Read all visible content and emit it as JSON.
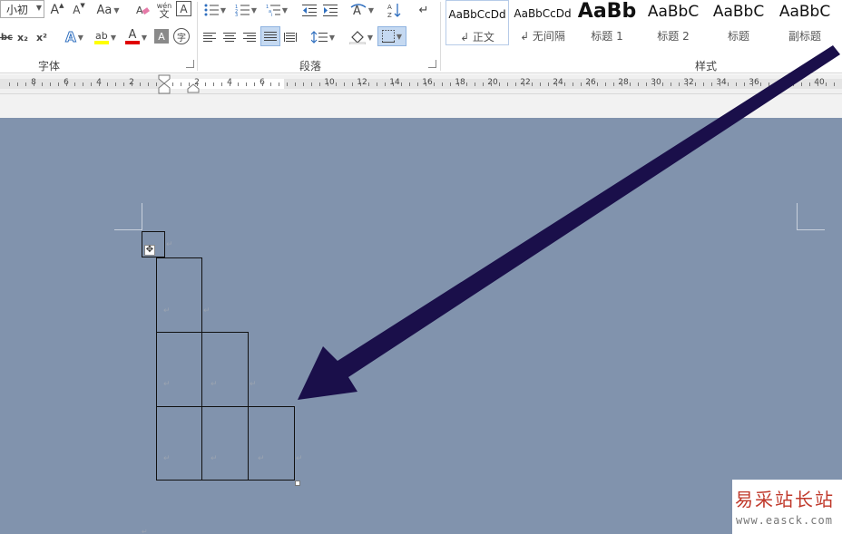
{
  "ribbon": {
    "font": {
      "size_value": "小初",
      "clear_format_icon": "eraser-icon",
      "phonetic_label": "wén",
      "phonetic_char": "文",
      "char_border_label": "A",
      "case_label": "Aa",
      "grow_label": "A",
      "shrink_label": "A",
      "strikethrough_label": "abc",
      "subscript_label": "x₂",
      "superscript_label": "x²",
      "text_effect_label": "A",
      "highlight_label": "ab",
      "font_color_label": "A",
      "char_shading_label": "A",
      "enclose_label": "字",
      "group_label": "字体"
    },
    "paragraph": {
      "group_label": "段落"
    },
    "styles": {
      "group_label": "样式",
      "tiles": [
        {
          "preview": "AaBbCcDd",
          "name": "↲ 正文"
        },
        {
          "preview": "AaBbCcDd",
          "name": "↲ 无间隔"
        },
        {
          "preview": "AaBb",
          "name": "标题 1"
        },
        {
          "preview": "AaBbC",
          "name": "标题 2"
        },
        {
          "preview": "AaBbC",
          "name": "标题"
        },
        {
          "preview": "AaBbC",
          "name": "副标题"
        }
      ]
    },
    "colors": {
      "highlight": "#ffff00",
      "font_color": "#e00000",
      "active_fill": "#c5d9f1"
    }
  },
  "ruler": {
    "left_labels": [
      "8",
      "6",
      "4",
      "2"
    ],
    "white_labels": [
      "2",
      "4",
      "6"
    ],
    "right_labels": [
      "10",
      "12",
      "14",
      "16",
      "18",
      "20",
      "22",
      "24",
      "26",
      "28",
      "30",
      "32",
      "34",
      "36",
      "38",
      "40"
    ]
  },
  "document": {
    "background": "#8193ad",
    "table_move_icon": "move-cross-icon",
    "paragraph_mark": "↵",
    "arrow_color": "#1a0f4a"
  },
  "watermark": {
    "name": "易采站长站",
    "url": "www.easck.com"
  }
}
